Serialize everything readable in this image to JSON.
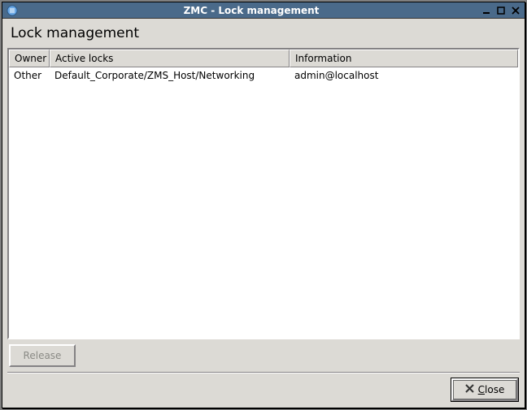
{
  "window": {
    "title": "ZMC - Lock management"
  },
  "page": {
    "title": "Lock management"
  },
  "table": {
    "headers": {
      "owner": "Owner",
      "active_locks": "Active locks",
      "information": "Information"
    },
    "rows": [
      {
        "owner": "Other",
        "active_locks": "Default_Corporate/ZMS_Host/Networking",
        "information": "admin@localhost"
      }
    ]
  },
  "buttons": {
    "release": "Release",
    "close_prefix": "C",
    "close_rest": "lose"
  }
}
